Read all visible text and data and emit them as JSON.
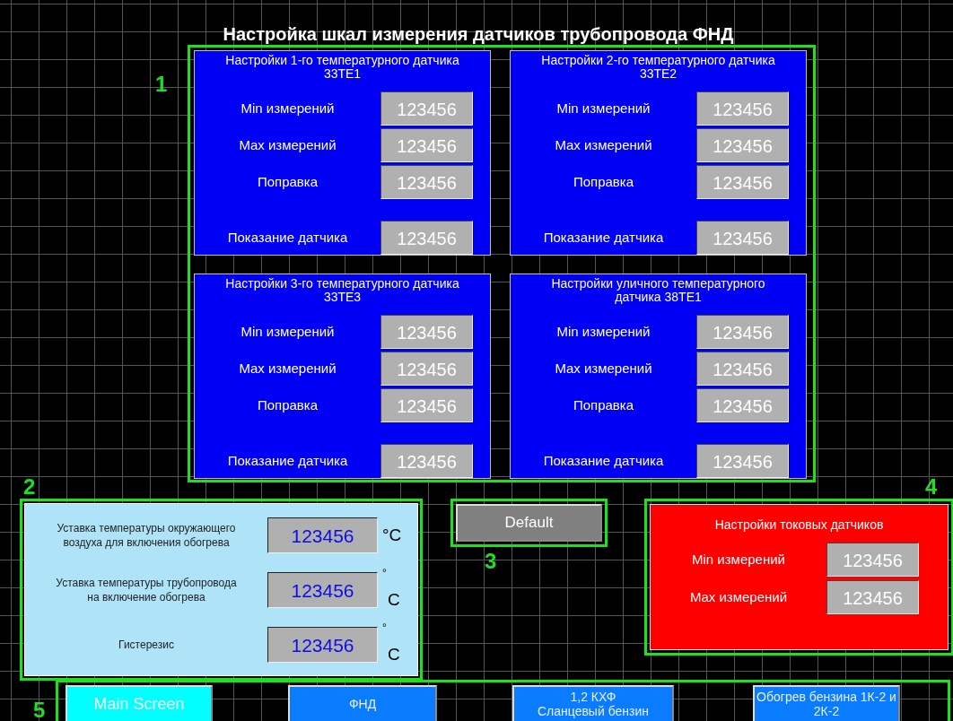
{
  "title": "Настройка шкал измерения датчиков трубопровода ФНД",
  "sensor_group": {
    "marker": "1",
    "panels": [
      {
        "title_lines": [
          "Настройки 1-го температурного датчика",
          "33TE1"
        ],
        "fields": [
          {
            "kind": "setting",
            "label": "Min измерений",
            "value": "123456"
          },
          {
            "kind": "setting",
            "label": "Max измерений",
            "value": "123456"
          },
          {
            "kind": "setting",
            "label": "Поправка",
            "value": "123456"
          },
          {
            "kind": "reading",
            "label": "Показание датчика",
            "value": "123456"
          }
        ]
      },
      {
        "title_lines": [
          "Настройки 2-го температурного датчика",
          "33TE2"
        ],
        "fields": [
          {
            "kind": "setting",
            "label": "Min измерений",
            "value": "123456"
          },
          {
            "kind": "setting",
            "label": "Max измерений",
            "value": "123456"
          },
          {
            "kind": "setting",
            "label": "Поправка",
            "value": "123456"
          },
          {
            "kind": "reading",
            "label": "Показание датчика",
            "value": "123456"
          }
        ]
      },
      {
        "title_lines": [
          "Настройки 3-го температурного датчика",
          "33TE3"
        ],
        "fields": [
          {
            "kind": "setting",
            "label": "Min измерений",
            "value": "123456"
          },
          {
            "kind": "setting",
            "label": "Max измерений",
            "value": "123456"
          },
          {
            "kind": "setting",
            "label": "Поправка",
            "value": "123456"
          },
          {
            "kind": "reading",
            "label": "Показание датчика",
            "value": "123456"
          }
        ]
      },
      {
        "title_lines": [
          "Настройки уличного температурного",
          "датчика 38TE1"
        ],
        "fields": [
          {
            "kind": "setting",
            "label": "Min измерений",
            "value": "123456"
          },
          {
            "kind": "setting",
            "label": "Max измерений",
            "value": "123456"
          },
          {
            "kind": "setting",
            "label": "Поправка",
            "value": "123456"
          },
          {
            "kind": "reading",
            "label": "Показание датчика",
            "value": "123456"
          }
        ]
      }
    ]
  },
  "heating_group": {
    "marker": "2",
    "rows": [
      {
        "label_lines": [
          "Уставка температуры окружающего",
          "воздуха для включения обогрева"
        ],
        "value": "123456",
        "unit": "°C"
      },
      {
        "label_lines": [
          "Уставка температуры трубопровода",
          "на включение обогрева"
        ],
        "value": "123456",
        "degree": "°",
        "unit": "C"
      },
      {
        "label_lines": [
          "Гистерезис"
        ],
        "value": "123456",
        "degree": "°",
        "unit": "C"
      }
    ]
  },
  "default_group": {
    "marker": "3",
    "button": "Default"
  },
  "current_group": {
    "marker": "4",
    "title": "Настройки токовых датчиков",
    "fields": [
      {
        "label": "Min измерений",
        "value": "123456"
      },
      {
        "label": "Max измерений",
        "value": "123456"
      }
    ]
  },
  "nav_group": {
    "marker": "5",
    "buttons": [
      {
        "label_lines": [
          "Main Screen"
        ],
        "selected": true
      },
      {
        "label_lines": [
          "ФНД"
        ],
        "selected": false
      },
      {
        "label_lines": [
          "1,2 КХФ",
          "Сланцевый бензин"
        ],
        "selected": false
      },
      {
        "label_lines": [
          "Обогрев бензина 1К-2 и",
          "2К-2"
        ],
        "selected": false
      }
    ]
  }
}
